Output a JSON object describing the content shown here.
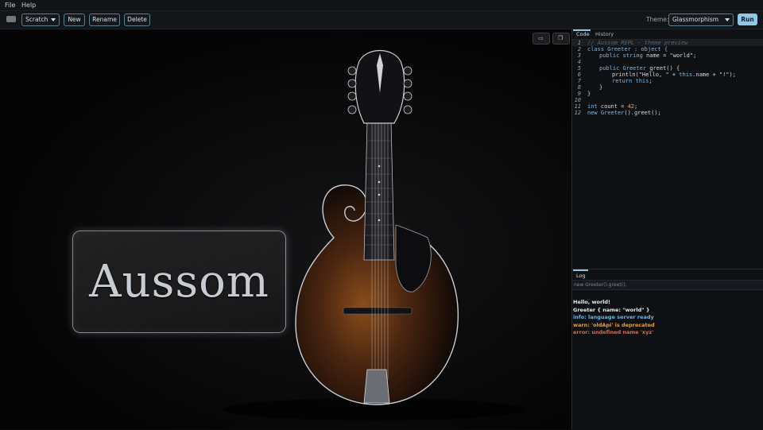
{
  "menubar": {
    "items": [
      "File",
      "Help"
    ]
  },
  "toolbar": {
    "scratch_select": "Scratch",
    "new_label": "New",
    "rename_label": "Rename",
    "delete_label": "Delete",
    "theme_label": "Theme:",
    "theme_value": "Glassmorphism",
    "run_label": "Run"
  },
  "stage": {
    "glass_text": "Aussom",
    "image_icon": "image-icon",
    "copy_icon": "copy-icon",
    "image_glyph": "▭",
    "copy_glyph": "❐"
  },
  "editor": {
    "tabs": [
      "Code",
      "History"
    ],
    "line_numbers": [
      "1",
      "2",
      "3",
      "4",
      "5",
      "6",
      "7",
      "8",
      "9",
      "10",
      "11",
      "12"
    ],
    "code": {
      "l1_comment": "// Aussom REPL - theme preview",
      "l2_kw_class": "class",
      "l2_name": " Greeter : object {",
      "l3_kw": "public string",
      "l3_rest": " name = \"world\";",
      "l5_kw": "public",
      "l5_type": " Greeter",
      "l5_rest": " greet() {",
      "l6_a": "println(\"Hello, \" + ",
      "l6_kw": "this",
      "l6_b": ".name + \"!\");",
      "l7_kw": "return this",
      "l7_rest": ";",
      "l8": "}",
      "l9": "}",
      "l11_kw": "int",
      "l11_a": " count = ",
      "l11_num": "42",
      "l11_b": ";",
      "l12_kw": "new",
      "l12_type": " Greeter",
      "l12_rest": "().greet();"
    }
  },
  "log": {
    "tab": "Log",
    "input_value": "new Greeter().greet();",
    "lines": [
      {
        "text": "Hello, world!",
        "color": "#e6e9ed"
      },
      {
        "text": "Greeter { name: \"world\" }",
        "color": "#e6e9ed"
      },
      {
        "text": "info: language server ready",
        "color": "#6fb3e6"
      },
      {
        "text": "warn: 'oldApi' is deprecated",
        "color": "#e0a04a"
      },
      {
        "text": "error: undefined name 'xyz'",
        "color": "#e0664f"
      }
    ]
  },
  "colors": {
    "accent": "#8fc8e6",
    "background": "#0b0b0c",
    "panel": "#0e1013"
  }
}
